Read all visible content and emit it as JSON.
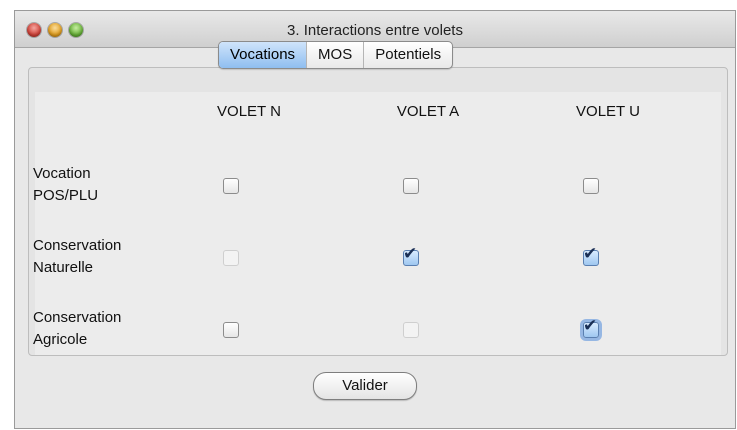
{
  "window": {
    "title": "3. Interactions entre volets"
  },
  "tabs": [
    {
      "label": "Vocations",
      "selected": true
    },
    {
      "label": "MOS",
      "selected": false
    },
    {
      "label": "Potentiels",
      "selected": false
    }
  ],
  "columns": [
    "VOLET N",
    "VOLET A",
    "VOLET U"
  ],
  "rows": [
    {
      "label_line1": "Vocation",
      "label_line2": "POS/PLU",
      "cells": [
        {
          "checked": false,
          "enabled": true
        },
        {
          "checked": false,
          "enabled": true
        },
        {
          "checked": false,
          "enabled": true
        }
      ]
    },
    {
      "label_line1": "Conservation",
      "label_line2": "Naturelle",
      "cells": [
        {
          "checked": false,
          "enabled": false
        },
        {
          "checked": true,
          "enabled": true
        },
        {
          "checked": true,
          "enabled": true
        }
      ]
    },
    {
      "label_line1": "Conservation",
      "label_line2": "Agricole",
      "cells": [
        {
          "checked": false,
          "enabled": true
        },
        {
          "checked": false,
          "enabled": false
        },
        {
          "checked": true,
          "enabled": true,
          "focused": true
        }
      ]
    }
  ],
  "button": {
    "label": "Valider"
  },
  "icons": {
    "checkmark": "check-icon"
  }
}
